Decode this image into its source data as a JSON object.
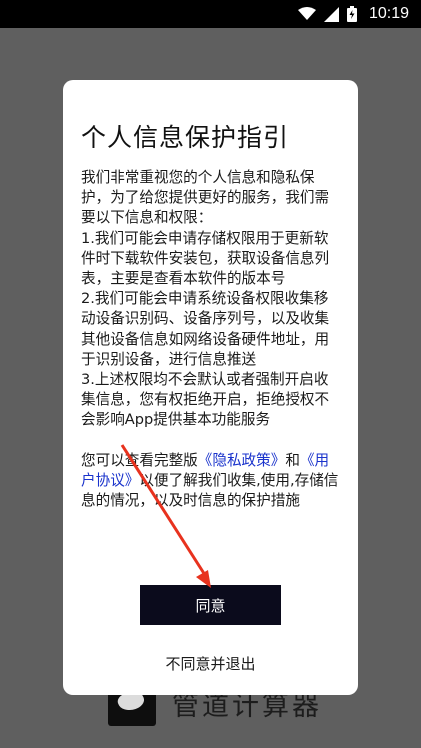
{
  "status_bar": {
    "time": "10:19",
    "icons": [
      "wifi-icon",
      "signal-icon",
      "battery-icon"
    ]
  },
  "app": {
    "name": "管道计算器"
  },
  "dialog": {
    "title": "个人信息保护指引",
    "intro": "我们非常重视您的个人信息和隐私保护，为了给您提供更好的服务，我们需要以下信息和权限：",
    "item1": "1.我们可能会申请存储权限用于更新软件时下载软件安装包，获取设备信息列表，主要是查看本软件的版本号",
    "item2": "2.我们可能会申请系统设备权限收集移动设备识别码、设备序列号，以及收集其他设备信息如网络设备硬件地址，用于识别设备，进行信息推送",
    "item3": "3.上述权限均不会默认或者强制开启收集信息，您有权拒绝开启，拒绝授权不会影响App提供基本功能服务",
    "outro_part1": "您可以查看完整版",
    "privacy_link": "《隐私政策》",
    "outro_part2": "和",
    "terms_link": "《用户协议》",
    "outro_part3": "以便了解我们收集,使用,存储信息的情况，以及时信息的保护措施",
    "agree_label": "同意",
    "decline_label": "不同意并退出"
  },
  "colors": {
    "overlay": "#5f5f5f",
    "dialog_bg": "#ffffff",
    "agree_button": "#0b0b1c",
    "link": "#1a33cc",
    "annotation_arrow": "#e8321e"
  }
}
